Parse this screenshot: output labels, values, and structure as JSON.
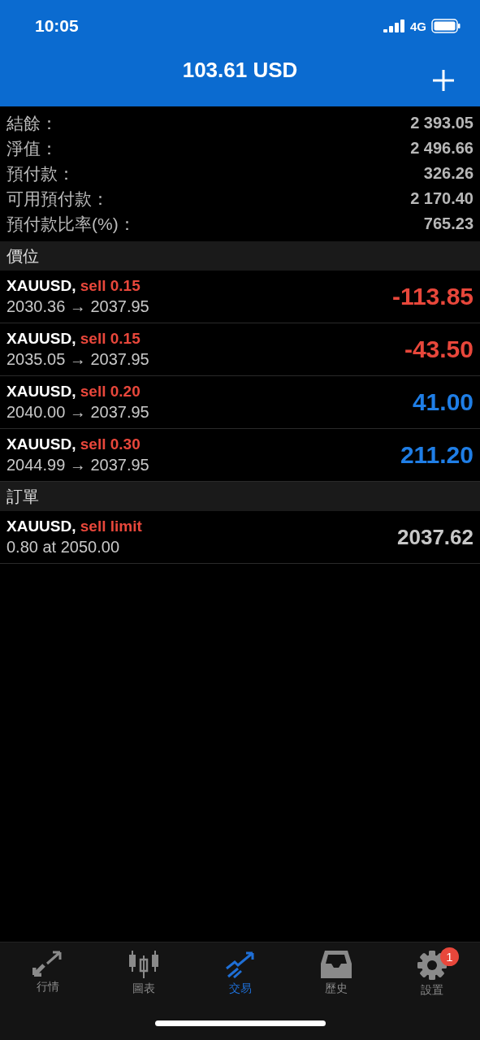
{
  "status_bar": {
    "time": "10:05",
    "network": "4G"
  },
  "header": {
    "title": "103.61 USD"
  },
  "summary": [
    {
      "label": "結餘：",
      "value": "2 393.05"
    },
    {
      "label": "淨值：",
      "value": "2 496.66"
    },
    {
      "label": "預付款：",
      "value": "326.26"
    },
    {
      "label": "可用預付款：",
      "value": "2 170.40"
    },
    {
      "label": "預付款比率(%)：",
      "value": "765.23"
    }
  ],
  "positions": {
    "title": "價位",
    "items": [
      {
        "symbol": "XAUUSD,",
        "side": "sell 0.15",
        "prices": "2030.36 → 2037.95",
        "profit": "-113.85",
        "color": "#e8473b"
      },
      {
        "symbol": "XAUUSD,",
        "side": "sell 0.15",
        "prices": "2035.05 → 2037.95",
        "profit": "-43.50",
        "color": "#e8473b"
      },
      {
        "symbol": "XAUUSD,",
        "side": "sell 0.20",
        "prices": "2040.00 → 2037.95",
        "profit": "41.00",
        "color": "#1f7ee6"
      },
      {
        "symbol": "XAUUSD,",
        "side": "sell 0.30",
        "prices": "2044.99 → 2037.95",
        "profit": "211.20",
        "color": "#1f7ee6"
      }
    ]
  },
  "orders": {
    "title": "訂單",
    "items": [
      {
        "symbol": "XAUUSD,",
        "side": "sell limit",
        "detail": "0.80 at 2050.00",
        "price": "2037.62"
      }
    ]
  },
  "tab_bar": [
    {
      "kind": "quotes",
      "label": "行情",
      "selected": false
    },
    {
      "kind": "chart",
      "label": "圖表",
      "selected": false
    },
    {
      "kind": "trade",
      "label": "交易",
      "selected": true
    },
    {
      "kind": "history",
      "label": "歷史",
      "selected": false
    },
    {
      "kind": "settings",
      "label": "設置",
      "selected": false,
      "badge": "1"
    }
  ]
}
